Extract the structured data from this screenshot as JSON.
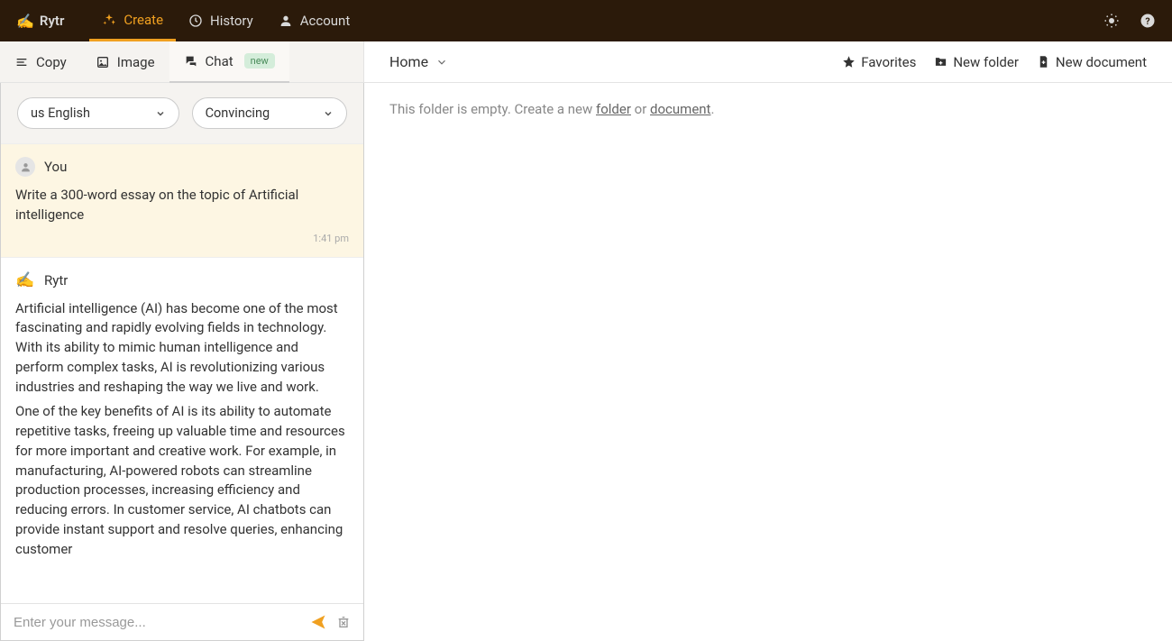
{
  "brand": "Rytr",
  "topnav": {
    "create": "Create",
    "history": "History",
    "account": "Account"
  },
  "subtabs": {
    "copy": "Copy",
    "image": "Image",
    "chat": "Chat",
    "chat_badge": "new"
  },
  "selectors": {
    "language": "us English",
    "tone": "Convincing"
  },
  "chat": {
    "you_label": "You",
    "rytr_label": "Rytr",
    "user_message": "Write a 300-word essay on the topic of Artificial intelligence",
    "user_time": "1:41 pm",
    "rytr_para1": "Artificial intelligence (AI) has become one of the most fascinating and rapidly evolving fields in technology. With its ability to mimic human intelligence and perform complex tasks, AI is revolutionizing various industries and reshaping the way we live and work.",
    "rytr_para2": "One of the key benefits of AI is its ability to automate repetitive tasks, freeing up valuable time and resources for more important and creative work. For example, in manufacturing, AI-powered robots can streamline production processes, increasing efficiency and reducing errors. In customer service, AI chatbots can provide instant support and resolve queries, enhancing customer",
    "input_placeholder": "Enter your message..."
  },
  "workspace": {
    "breadcrumb": "Home",
    "favorites": "Favorites",
    "new_folder": "New folder",
    "new_document": "New document",
    "empty_prefix": "This folder is empty. Create a new ",
    "folder_link": "folder",
    "or": " or ",
    "document_link": "document",
    "period": "."
  }
}
